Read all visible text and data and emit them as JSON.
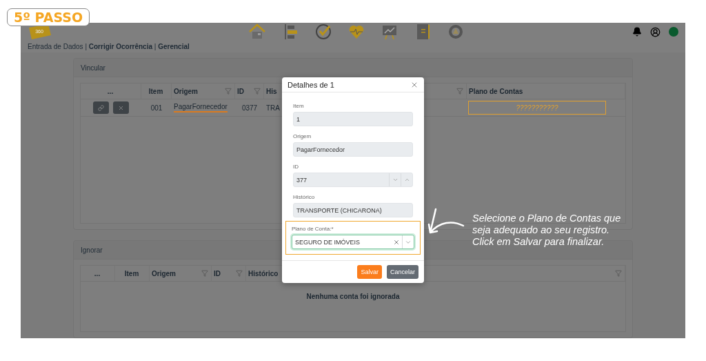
{
  "step_badge": "5º PASSO",
  "header": {
    "logo_text": "360"
  },
  "breadcrumb": "Entrada de Dados | **Corrigir Ocorrência** | **Gerencial**",
  "vincular": {
    "title": "Vincular",
    "columns": [
      {
        "label": "...",
        "filter": false
      },
      {
        "label": "Item",
        "filter": false
      },
      {
        "label": "Origem",
        "filter": true
      },
      {
        "label": "ID",
        "filter": true
      },
      {
        "label": "His",
        "filter": true
      },
      {
        "label": "Plano de Contas",
        "filter": false
      }
    ],
    "rows": [
      {
        "cells": [
          {
            "kind": "actions",
            "actions": [
              {
                "kind": "link"
              },
              {
                "kind": "remove"
              }
            ]
          },
          {
            "kind": "text",
            "text": "001"
          },
          {
            "kind": "text",
            "text": "PagarFornecedor",
            "underlined": true
          },
          {
            "kind": "text",
            "text": "0377"
          },
          {
            "kind": "text",
            "text": "TRA"
          },
          {
            "kind": "text",
            "text": "???????????",
            "highlighted": true
          }
        ]
      }
    ]
  },
  "ignorar": {
    "title": "Ignorar",
    "columns": [
      {
        "label": "...",
        "filter": false
      },
      {
        "label": "Item",
        "filter": false
      },
      {
        "label": "Origem",
        "filter": true
      },
      {
        "label": "ID",
        "filter": true
      },
      {
        "label": "Histórico",
        "filter": true
      }
    ],
    "empty_message": "Nenhuma conta foi ignorada"
  },
  "modal": {
    "title": "Detalhes de 1",
    "fields": [
      {
        "kind": "text",
        "label": "Item",
        "value": "1",
        "disabled": true
      },
      {
        "kind": "text",
        "label": "Origem",
        "value": "PagarFornecedor",
        "disabled": true
      },
      {
        "kind": "spin",
        "label": "ID",
        "value": "377",
        "disabled": true
      },
      {
        "kind": "text",
        "label": "Histórico",
        "value": "TRANSPORTE (CHICARONA)",
        "disabled": true
      },
      {
        "kind": "select",
        "label": "Plano de Conta:*",
        "value": "SEGURO DE IMÓVEIS",
        "disabled": false,
        "highlighted": true
      }
    ],
    "buttons": [
      {
        "label": "Salvar",
        "kind": "primary"
      },
      {
        "label": "Cancelar",
        "kind": "secondary"
      }
    ]
  },
  "annotation": "Selecione o Plano de Contas que\nseja adequado ao seu registro.\nClick em Salvar para finalizar."
}
